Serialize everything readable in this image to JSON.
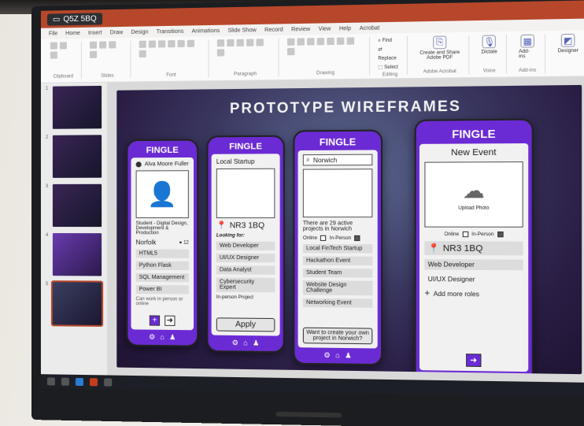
{
  "window": {
    "meeting_badge": "Q5Z 5BQ"
  },
  "ribbon": {
    "tabs": [
      "File",
      "Home",
      "Insert",
      "Draw",
      "Design",
      "Transitions",
      "Animations",
      "Slide Show",
      "Record",
      "Review",
      "View",
      "Help",
      "Acrobat"
    ],
    "groups": [
      "Clipboard",
      "Slides",
      "Font",
      "Paragraph",
      "Drawing",
      "Editing",
      "Adobe Acrobat",
      "Voice",
      "Add-ins"
    ],
    "find_label": "Find",
    "replace_label": "Replace",
    "select_label": "Select",
    "create_share_label": "Create and Share Adobe PDF",
    "dictate_label": "Dictate",
    "addins_label": "Add-ins",
    "designer_label": "Designer"
  },
  "slide": {
    "title": "PROTOTYPE WIREFRAMES"
  },
  "phones": {
    "brand": "FINGLE",
    "profile": {
      "name": "Alva Moore Fuller",
      "student_label": "Student - Digital Design, Development & Production",
      "location": "Norfolk",
      "count": "12",
      "skills": [
        "HTML5",
        "Python Flask",
        "SQL Management",
        "Power BI"
      ],
      "note": "Can work in person or online"
    },
    "startup": {
      "title": "Local Startup",
      "postcode": "NR3 1BQ",
      "looking_for": "Looking for:",
      "roles": [
        "Web Developer",
        "UI/UX Designer",
        "Data Analyst",
        "Cybersecurity Expert"
      ],
      "mode": "In-person Project",
      "apply": "Apply"
    },
    "search": {
      "query": "Norwich",
      "count_text": "There are 29 active projects in Norwich",
      "online": "Online",
      "in_person": "In-Person",
      "results": [
        "Local FinTech Startup",
        "Hackathon Event",
        "Student Team",
        "Website Design Challenge",
        "Networking Event"
      ],
      "prompt": "Want to create your own project in Norwich?"
    },
    "event": {
      "title": "New Event",
      "upload": "Upload Photo",
      "online": "Online",
      "in_person": "In-Person",
      "postcode": "NR3 1BQ",
      "roles": [
        "Web Developer",
        "UI/UX Designer"
      ],
      "add_roles": "Add more roles"
    }
  },
  "colors": {
    "brand_purple": "#6b2bd4",
    "ppt_red": "#b7472a"
  }
}
